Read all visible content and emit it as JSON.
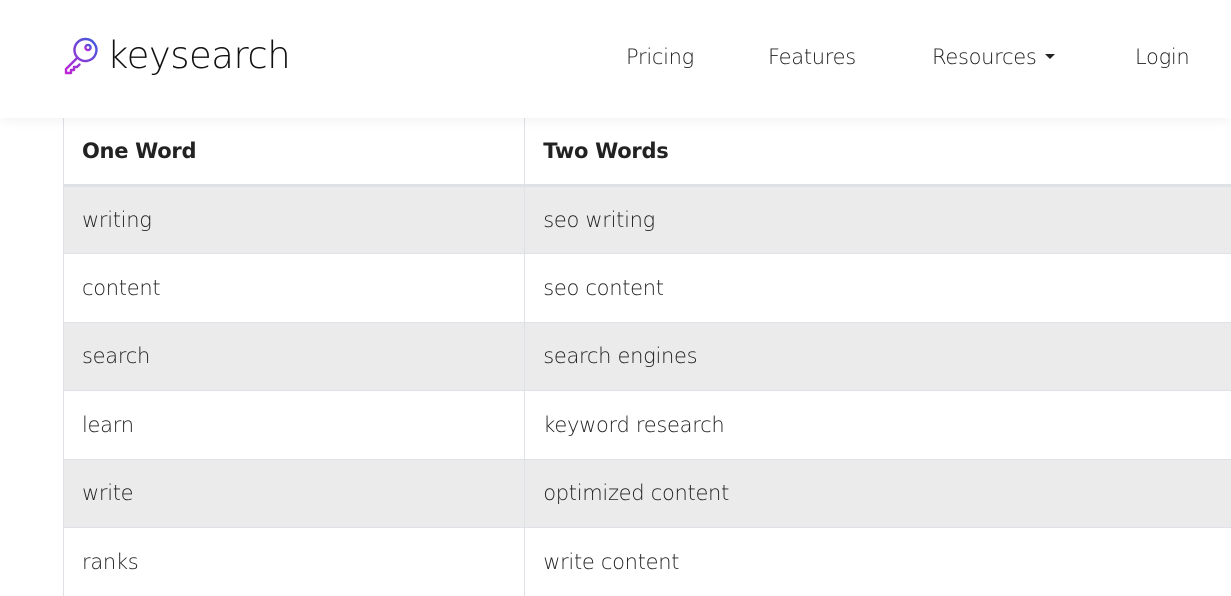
{
  "header": {
    "brand": "keysearch",
    "brand_icon": "key-icon",
    "nav": [
      {
        "label": "Pricing"
      },
      {
        "label": "Features"
      },
      {
        "label": "Resources",
        "has_dropdown": true
      },
      {
        "label": "Login"
      }
    ]
  },
  "colors": {
    "key_gradient_start": "#3b5bdb",
    "key_gradient_end": "#c026d3",
    "stripe": "#ebebeb",
    "border": "#dee2e6"
  },
  "table": {
    "columns": [
      "One Word",
      "Two Words"
    ],
    "rows": [
      [
        "writing",
        "seo writing"
      ],
      [
        "content",
        "seo content"
      ],
      [
        "search",
        "search engines"
      ],
      [
        "learn",
        "keyword research"
      ],
      [
        "write",
        "optimized content"
      ],
      [
        "ranks",
        "write content"
      ]
    ]
  }
}
